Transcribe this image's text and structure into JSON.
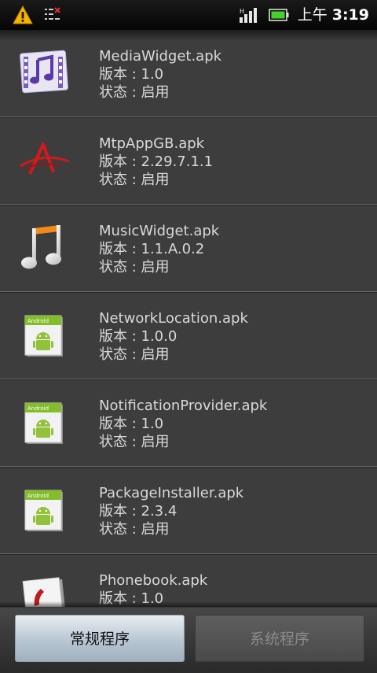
{
  "status_bar": {
    "icons": [
      "warning-icon",
      "notification-icon",
      "signal-icon",
      "battery-icon"
    ],
    "ampm": "上午",
    "time": "3:19"
  },
  "apps": [
    {
      "name": "MediaWidget.apk",
      "version": "版本 : 1.0",
      "status": "状态 : 启用",
      "icon": "media-widget-icon"
    },
    {
      "name": "MtpAppGB.apk",
      "version": "版本 : 2.29.7.1.1",
      "status": "状态 : 启用",
      "icon": "mtp-app-icon"
    },
    {
      "name": "MusicWidget.apk",
      "version": "版本 : 1.1.A.0.2",
      "status": "状态 : 启用",
      "icon": "music-note-icon"
    },
    {
      "name": "NetworkLocation.apk",
      "version": "版本 : 1.0.0",
      "status": "状态 : 启用",
      "icon": "android-app-icon"
    },
    {
      "name": "NotificationProvider.apk",
      "version": "版本 : 1.0",
      "status": "状态 : 启用",
      "icon": "android-app-icon"
    },
    {
      "name": "PackageInstaller.apk",
      "version": "版本 : 2.3.4",
      "status": "状态 : 启用",
      "icon": "android-app-icon"
    },
    {
      "name": "Phonebook.apk",
      "version": "版本 : 1.0",
      "status": "",
      "icon": "phonebook-icon"
    }
  ],
  "bottom_bar": {
    "regular_label": "常规程序",
    "system_label": "系统程序",
    "active_tab": "regular"
  },
  "colors": {
    "background": "#3d3d3d",
    "text": "#d9d9d9",
    "active_button": "#b8c6d2",
    "inactive_button": "#555555"
  }
}
